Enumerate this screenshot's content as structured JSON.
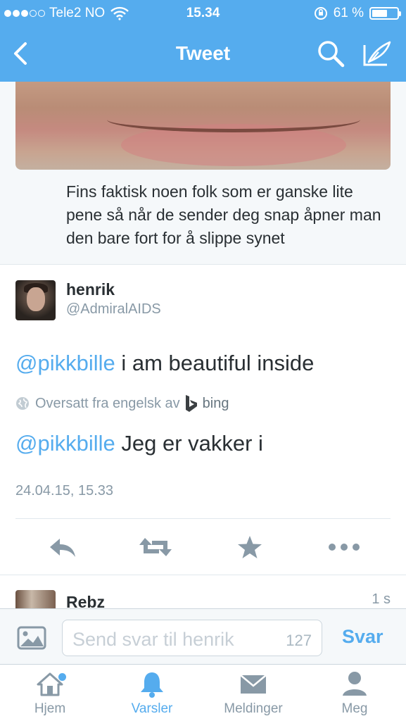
{
  "status_bar": {
    "carrier": "Tele2 NO",
    "time": "15.34",
    "battery_percent": "61 %",
    "battery_level": 0.61
  },
  "nav": {
    "title": "Tweet"
  },
  "quoted_tweet": {
    "text": "Fins faktisk noen folk som er ganske lite pene så når de sender deg snap åpner man den bare fort for å slippe synet"
  },
  "tweet": {
    "name": "henrik",
    "handle": "@AdmiralAIDS",
    "mention": "@pikkbille",
    "text": " i am beautiful inside",
    "translation_label": "Oversatt fra engelsk av",
    "translation_provider": "bing",
    "translated_mention": "@pikkbille",
    "translated_text": " Jeg er vakker i",
    "timestamp": "24.04.15, 15.33"
  },
  "actions": {
    "reply_icon": "reply-icon",
    "retweet_icon": "retweet-icon",
    "favorite_icon": "star-icon",
    "more_icon": "more-icon"
  },
  "reply_preview": {
    "name": "Rebz",
    "time": "1 s"
  },
  "reply_bar": {
    "placeholder": "Send svar til henrik",
    "char_count": "127",
    "send_label": "Svar"
  },
  "tabs": [
    {
      "label": "Hjem",
      "icon": "home-icon",
      "active": false
    },
    {
      "label": "Varsler",
      "icon": "bell-icon",
      "active": true
    },
    {
      "label": "Meldinger",
      "icon": "envelope-icon",
      "active": false
    },
    {
      "label": "Meg",
      "icon": "person-icon",
      "active": false
    }
  ],
  "colors": {
    "accent": "#55acee",
    "text": "#292f33",
    "muted": "#8899a6"
  }
}
